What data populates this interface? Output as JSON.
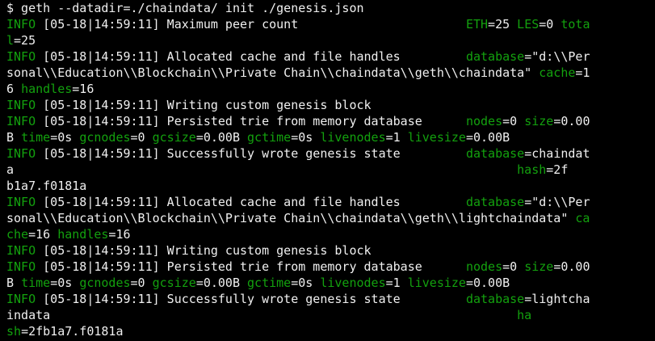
{
  "terminal": {
    "colors": {
      "background": "#000000",
      "text": "#f0f0f0",
      "accent_green": "#13a10e"
    },
    "lines": [
      [
        {
          "t": "$ geth --datadir=./chaindata/ init ./genesis.json",
          "c": "w"
        }
      ],
      [
        {
          "t": "INFO",
          "c": "g"
        },
        {
          "t": " [05-18|14:59:11] Maximum peer count                       ",
          "c": "w"
        },
        {
          "t": "ETH",
          "c": "g"
        },
        {
          "t": "=25 ",
          "c": "w"
        },
        {
          "t": "LES",
          "c": "g"
        },
        {
          "t": "=0 ",
          "c": "w"
        },
        {
          "t": "tota",
          "c": "g"
        }
      ],
      [
        {
          "t": "l",
          "c": "g"
        },
        {
          "t": "=25",
          "c": "w"
        }
      ],
      [
        {
          "t": "INFO",
          "c": "g"
        },
        {
          "t": " [05-18|14:59:11] Allocated cache and file handles         ",
          "c": "w"
        },
        {
          "t": "database",
          "c": "g"
        },
        {
          "t": "=\"d:\\\\Per",
          "c": "w"
        }
      ],
      [
        {
          "t": "sonal\\\\Education\\\\Blockchain\\\\Private Chain\\\\chaindata\\\\geth\\\\chaindata\" ",
          "c": "w"
        },
        {
          "t": "cache",
          "c": "g"
        },
        {
          "t": "=1",
          "c": "w"
        }
      ],
      [
        {
          "t": "6 ",
          "c": "w"
        },
        {
          "t": "handles",
          "c": "g"
        },
        {
          "t": "=16",
          "c": "w"
        }
      ],
      [
        {
          "t": "INFO",
          "c": "g"
        },
        {
          "t": " [05-18|14:59:11] Writing custom genesis block",
          "c": "w"
        }
      ],
      [
        {
          "t": "INFO",
          "c": "g"
        },
        {
          "t": " [05-18|14:59:11] Persisted trie from memory database      ",
          "c": "w"
        },
        {
          "t": "nodes",
          "c": "g"
        },
        {
          "t": "=0 ",
          "c": "w"
        },
        {
          "t": "size",
          "c": "g"
        },
        {
          "t": "=0.00",
          "c": "w"
        }
      ],
      [
        {
          "t": "B ",
          "c": "w"
        },
        {
          "t": "time",
          "c": "g"
        },
        {
          "t": "=0s ",
          "c": "w"
        },
        {
          "t": "gcnodes",
          "c": "g"
        },
        {
          "t": "=0 ",
          "c": "w"
        },
        {
          "t": "gcsize",
          "c": "g"
        },
        {
          "t": "=0.00B ",
          "c": "w"
        },
        {
          "t": "gctime",
          "c": "g"
        },
        {
          "t": "=0s ",
          "c": "w"
        },
        {
          "t": "livenodes",
          "c": "g"
        },
        {
          "t": "=1 ",
          "c": "w"
        },
        {
          "t": "livesize",
          "c": "g"
        },
        {
          "t": "=0.00B",
          "c": "w"
        }
      ],
      [
        {
          "t": "INFO",
          "c": "g"
        },
        {
          "t": " [05-18|14:59:11] Successfully wrote genesis state         ",
          "c": "w"
        },
        {
          "t": "database",
          "c": "g"
        },
        {
          "t": "=chaindat",
          "c": "w"
        }
      ],
      [
        {
          "t": "a                                                                     ",
          "c": "w"
        },
        {
          "t": "hash",
          "c": "g"
        },
        {
          "t": "=2f",
          "c": "w"
        }
      ],
      [
        {
          "t": "b1a7.f0181a",
          "c": "w"
        }
      ],
      [
        {
          "t": "INFO",
          "c": "g"
        },
        {
          "t": " [05-18|14:59:11] Allocated cache and file handles         ",
          "c": "w"
        },
        {
          "t": "database",
          "c": "g"
        },
        {
          "t": "=\"d:\\\\Per",
          "c": "w"
        }
      ],
      [
        {
          "t": "sonal\\\\Education\\\\Blockchain\\\\Private Chain\\\\chaindata\\\\geth\\\\lightchaindata\" ",
          "c": "w"
        },
        {
          "t": "ca",
          "c": "g"
        }
      ],
      [
        {
          "t": "che",
          "c": "g"
        },
        {
          "t": "=16 ",
          "c": "w"
        },
        {
          "t": "handles",
          "c": "g"
        },
        {
          "t": "=16",
          "c": "w"
        }
      ],
      [
        {
          "t": "INFO",
          "c": "g"
        },
        {
          "t": " [05-18|14:59:11] Writing custom genesis block",
          "c": "w"
        }
      ],
      [
        {
          "t": "INFO",
          "c": "g"
        },
        {
          "t": " [05-18|14:59:11] Persisted trie from memory database      ",
          "c": "w"
        },
        {
          "t": "nodes",
          "c": "g"
        },
        {
          "t": "=0 ",
          "c": "w"
        },
        {
          "t": "size",
          "c": "g"
        },
        {
          "t": "=0.00",
          "c": "w"
        }
      ],
      [
        {
          "t": "B ",
          "c": "w"
        },
        {
          "t": "time",
          "c": "g"
        },
        {
          "t": "=0s ",
          "c": "w"
        },
        {
          "t": "gcnodes",
          "c": "g"
        },
        {
          "t": "=0 ",
          "c": "w"
        },
        {
          "t": "gcsize",
          "c": "g"
        },
        {
          "t": "=0.00B ",
          "c": "w"
        },
        {
          "t": "gctime",
          "c": "g"
        },
        {
          "t": "=0s ",
          "c": "w"
        },
        {
          "t": "livenodes",
          "c": "g"
        },
        {
          "t": "=1 ",
          "c": "w"
        },
        {
          "t": "livesize",
          "c": "g"
        },
        {
          "t": "=0.00B",
          "c": "w"
        }
      ],
      [
        {
          "t": "INFO",
          "c": "g"
        },
        {
          "t": " [05-18|14:59:11] Successfully wrote genesis state         ",
          "c": "w"
        },
        {
          "t": "database",
          "c": "g"
        },
        {
          "t": "=lightcha",
          "c": "w"
        }
      ],
      [
        {
          "t": "indata                                                                ",
          "c": "w"
        },
        {
          "t": "ha",
          "c": "g"
        }
      ],
      [
        {
          "t": "sh",
          "c": "g"
        },
        {
          "t": "=2fb1a7.f0181a",
          "c": "w"
        }
      ]
    ]
  }
}
